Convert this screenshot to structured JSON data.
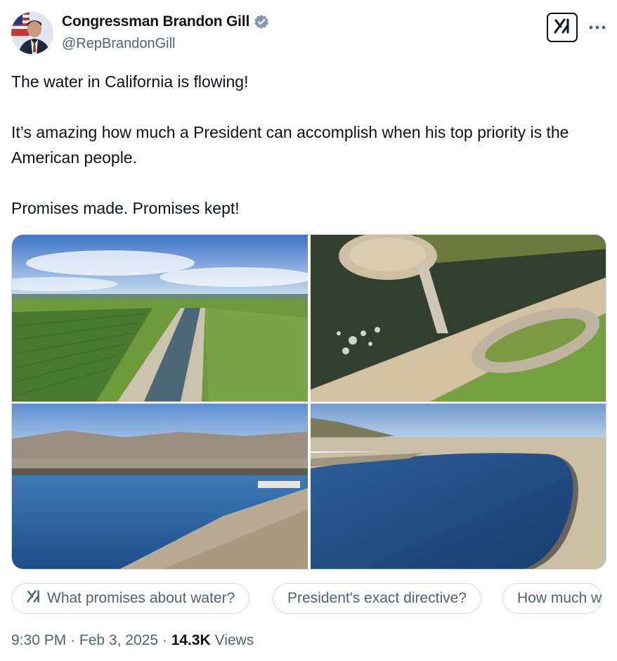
{
  "author": {
    "name": "Congressman Brandon Gill",
    "handle": "@RepBrandonGill",
    "verified": true,
    "verified_color": "#829aab"
  },
  "post": {
    "lines": [
      "The water in California is flowing!",
      "It’s amazing how much a President can accomplish when his top priority is the American people.",
      "Promises made. Promises kept!"
    ]
  },
  "media": {
    "count": 4,
    "icons": [
      "canal-farmland-photo",
      "canal-spillway-aerial-photo",
      "reservoir-dam-photo",
      "canal-bend-photo"
    ]
  },
  "grok_prompts": [
    "What promises about water?",
    "President's exact directive?",
    "How much w"
  ],
  "meta": {
    "time": "9:30 PM",
    "separator": "·",
    "date": "Feb 3, 2025",
    "views_count": "14.3K",
    "views_label": "Views"
  },
  "icons": {
    "grok": "grok-icon",
    "more": "more-options-icon",
    "verified": "verified-badge-icon"
  }
}
